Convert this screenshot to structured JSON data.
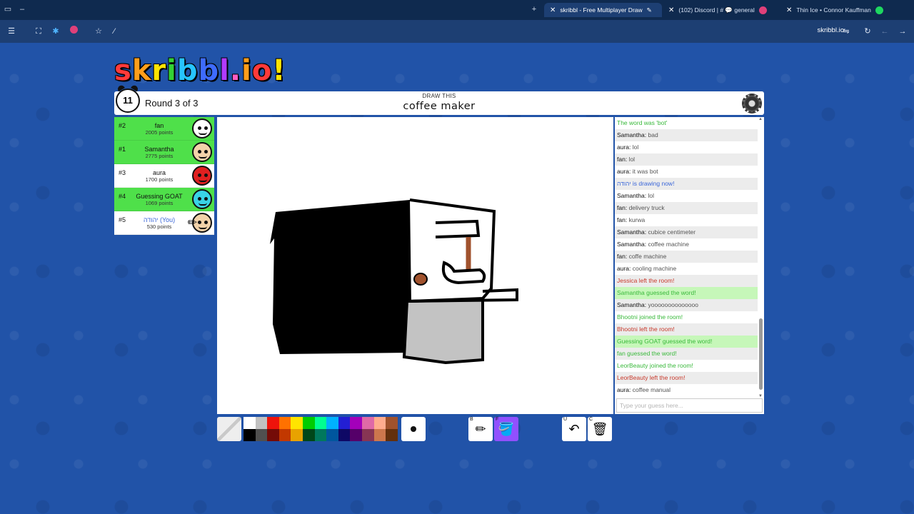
{
  "browser": {
    "tabs": [
      {
        "label": "skribbl - Free Multiplayer Draw",
        "active": true
      },
      {
        "label": "(102) Discord | # 💬 general",
        "active": false
      },
      {
        "label": "Thin Ice • Connor Kauffman",
        "active": false
      }
    ],
    "url": "skribbl.io"
  },
  "game": {
    "logo": "skribbl.io",
    "timer": "11",
    "round": "Round 3 of 3",
    "draw_this": "DRAW THIS",
    "word": "coffee maker"
  },
  "players": [
    {
      "rank": "#2",
      "name": "fan",
      "points": "2005 points",
      "guessed": true,
      "avatar_color": "#ffffff"
    },
    {
      "rank": "#1",
      "name": "Samantha",
      "points": "2775 points",
      "guessed": true,
      "avatar_color": "#f2d2a9"
    },
    {
      "rank": "#3",
      "name": "aura",
      "points": "1700 points",
      "guessed": false,
      "avatar_color": "#e02020"
    },
    {
      "rank": "#4",
      "name": "Guessing GOAT",
      "points": "1069 points",
      "guessed": true,
      "avatar_color": "#39d3e6"
    },
    {
      "rank": "#5",
      "name": "יהודה (You)",
      "points": "530 points",
      "guessed": false,
      "avatar_color": "#f2d2a9"
    }
  ],
  "chat": {
    "messages": [
      {
        "type": "green",
        "text": "The word was 'bot'"
      },
      {
        "type": "msg",
        "who": "Samantha:",
        "text": "bad"
      },
      {
        "type": "msg",
        "who": "aura:",
        "text": "lol"
      },
      {
        "type": "msg",
        "who": "fan:",
        "text": "lol"
      },
      {
        "type": "msg",
        "who": "aura:",
        "text": "it was bot"
      },
      {
        "type": "blue",
        "text": "יהודה is drawing now!"
      },
      {
        "type": "msg",
        "who": "Samantha:",
        "text": "lol"
      },
      {
        "type": "msg",
        "who": "fan:",
        "text": "delivery truck"
      },
      {
        "type": "msg",
        "who": "fan:",
        "text": "kurwa"
      },
      {
        "type": "msg",
        "who": "Samantha:",
        "text": "cubice centimeter"
      },
      {
        "type": "msg",
        "who": "Samantha:",
        "text": "coffee machine"
      },
      {
        "type": "msg",
        "who": "fan:",
        "text": "coffe machine"
      },
      {
        "type": "msg",
        "who": "aura:",
        "text": "cooling machine"
      },
      {
        "type": "red",
        "text": "Jessica left the room!"
      },
      {
        "type": "greenbg",
        "text": "Samantha guessed the word!"
      },
      {
        "type": "msg",
        "who": "Samantha:",
        "text": "yoooooooooooooo"
      },
      {
        "type": "green",
        "text": "Bhootni joined the room!"
      },
      {
        "type": "red",
        "text": "Bhootni left the room!"
      },
      {
        "type": "greenbg",
        "text": "Guessing GOAT guessed the word!"
      },
      {
        "type": "green",
        "text": "fan guessed the word!"
      },
      {
        "type": "green",
        "text": "LeorBeauty joined the room!"
      },
      {
        "type": "red",
        "text": "LeorBeauty left the room!"
      },
      {
        "type": "msg",
        "who": "aura:",
        "text": "coffee manual"
      }
    ],
    "placeholder": "Type your guess here..."
  },
  "toolbar": {
    "palette": [
      "#ffffff",
      "#c1c1c1",
      "#ef130b",
      "#ff7100",
      "#ffe400",
      "#00cc00",
      "#00ff91",
      "#00b2ff",
      "#231fd3",
      "#a300ba",
      "#df69a7",
      "#ffac8e",
      "#a0522d",
      "#000000",
      "#505050",
      "#740b07",
      "#c23800",
      "#e8a200",
      "#004619",
      "#00785d",
      "#00569e",
      "#0e0865",
      "#550069",
      "#873554",
      "#cc774d",
      "#63300d"
    ],
    "tools": [
      {
        "key": "B",
        "name": "pencil",
        "glyph": "✏"
      },
      {
        "key": "F",
        "name": "fill",
        "glyph": "🪣"
      },
      {
        "key": "U",
        "name": "undo",
        "glyph": "↶"
      },
      {
        "key": "C",
        "name": "clear",
        "glyph": "🗑"
      }
    ]
  }
}
